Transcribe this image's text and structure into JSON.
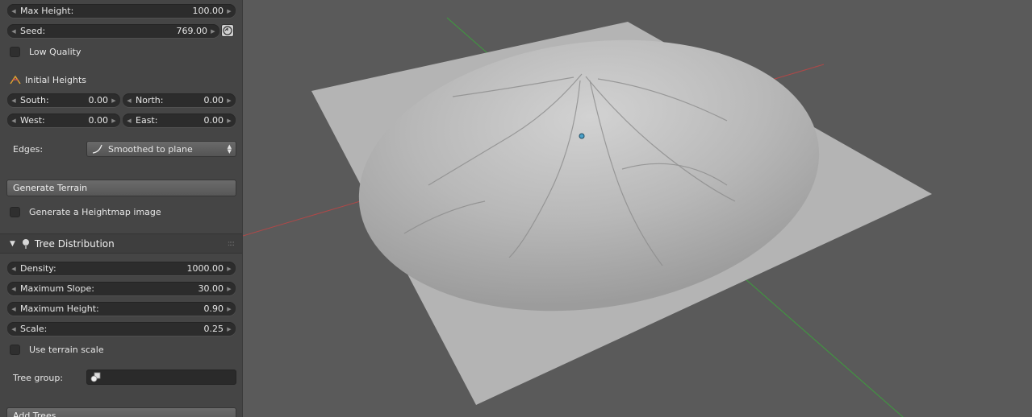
{
  "panel": {
    "max_height": {
      "label": "Max Height:",
      "value": "100.00"
    },
    "seed": {
      "label": "Seed:",
      "value": "769.00"
    },
    "low_quality": {
      "label": "Low Quality",
      "checked": false
    },
    "initial_heights": {
      "title": "Initial Heights",
      "icon": "terrain-icon"
    },
    "south": {
      "label": "South:",
      "value": "0.00"
    },
    "north": {
      "label": "North:",
      "value": "0.00"
    },
    "west": {
      "label": "West:",
      "value": "0.00"
    },
    "east": {
      "label": "East:",
      "value": "0.00"
    },
    "edges": {
      "label": "Edges:",
      "value": "Smoothed to plane"
    },
    "generate_terrain": {
      "label": "Generate Terrain"
    },
    "generate_heightmap": {
      "label": "Generate a Heightmap image",
      "checked": false
    },
    "tree_distribution": {
      "title": "Tree Distribution",
      "expanded": true
    },
    "density": {
      "label": "Density:",
      "value": "1000.00"
    },
    "max_slope": {
      "label": "Maximum Slope:",
      "value": "30.00"
    },
    "max_tree_height": {
      "label": "Maximum Height:",
      "value": "0.90"
    },
    "scale": {
      "label": "Scale:",
      "value": "0.25"
    },
    "use_terrain_scale": {
      "label": "Use terrain scale",
      "checked": false
    },
    "tree_group": {
      "label": "Tree group:",
      "value": ""
    },
    "add_trees": {
      "label": "Add Trees"
    }
  },
  "viewport": {
    "background": "#5a5a5a",
    "x_axis_color": "#b04848",
    "y_axis_color": "#3e9c3e",
    "terrain_color": "#b4b4b4"
  }
}
